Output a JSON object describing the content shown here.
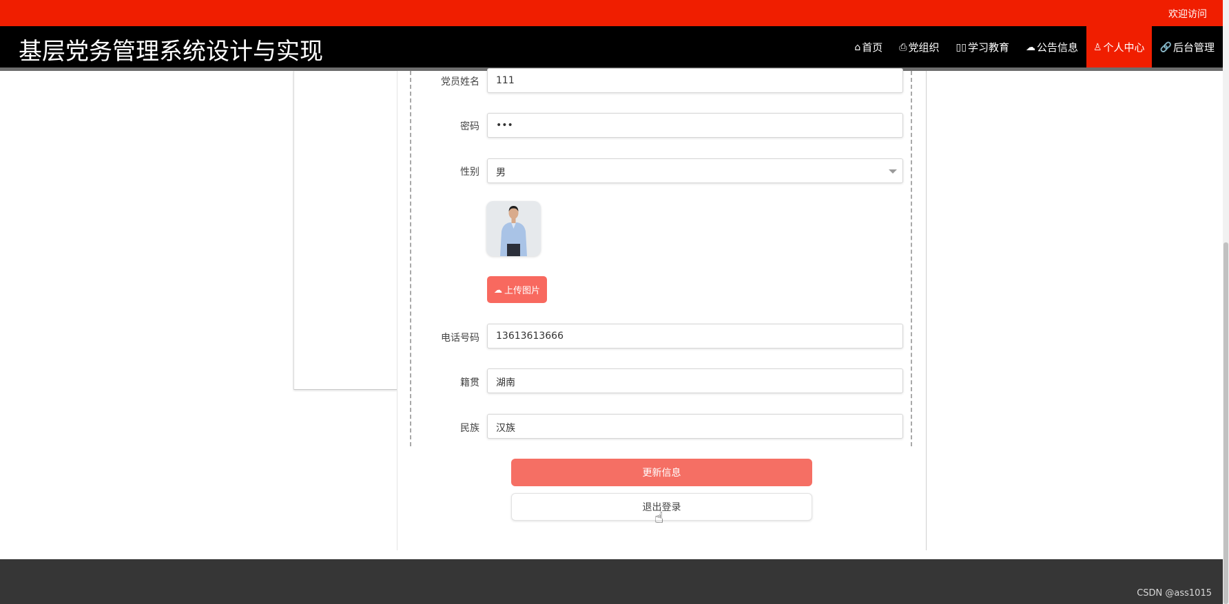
{
  "top_bar": {
    "welcome": "欢迎访问"
  },
  "header": {
    "title": "基层党务管理系统设计与实现",
    "nav": [
      {
        "icon": "home-icon",
        "glyph": "⌂",
        "label": "首页",
        "active": false
      },
      {
        "icon": "org-icon",
        "glyph": "⎙",
        "label": "党组织",
        "active": false
      },
      {
        "icon": "book-icon",
        "glyph": "▯▯",
        "label": "学习教育",
        "active": false
      },
      {
        "icon": "notice-icon",
        "glyph": "☁",
        "label": "公告信息",
        "active": false
      },
      {
        "icon": "user-icon",
        "glyph": "♙",
        "label": "个人中心",
        "active": true
      },
      {
        "icon": "link-icon",
        "glyph": "🔗",
        "label": "后台管理",
        "active": false
      }
    ]
  },
  "form": {
    "name_label": "党员姓名",
    "name_value": "111",
    "password_label": "密码",
    "password_value": "•••",
    "gender_label": "性别",
    "gender_value": "男",
    "upload_label": "上传图片",
    "phone_label": "电话号码",
    "phone_value": "13613613666",
    "origin_label": "籍贯",
    "origin_value": "湖南",
    "ethnicity_label": "民族",
    "ethnicity_value": "汉族"
  },
  "actions": {
    "update": "更新信息",
    "logout": "退出登录"
  },
  "footer": {
    "watermark": "CSDN @ass1015"
  },
  "colors": {
    "topbar": "#f01e00",
    "navbar": "#000000",
    "accent": "#f56f64",
    "footer": "#363636"
  }
}
